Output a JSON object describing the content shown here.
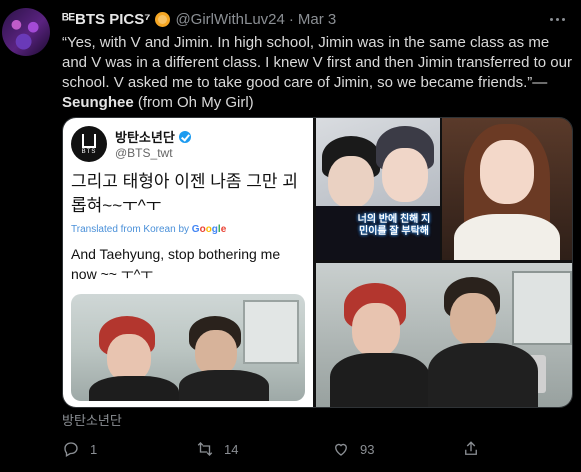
{
  "tweet": {
    "display_name": "ᴮᴱBTS PICS⁷",
    "handle": "@GirlWithLuv24",
    "separator": "·",
    "date": "Mar 3",
    "text_quote": "“Yes, with V and Jimin. In high school, Jimin was in the same class as me and V was in a different class. I knew V first and then Jimin transferred to our school. V asked me to take good care of Jimin, so we became friends.”—",
    "text_author": "Seunghee",
    "text_source": " (from Oh My Girl)"
  },
  "embedded": {
    "logo_text": "BTS",
    "name": "방탄소년단",
    "handle": "@BTS_twt",
    "korean_text": "그리고 태형아 이젠 나좀 그만 괴롭혀~~ㅜ^ㅜ",
    "translated_prefix": "Translated from Korean by ",
    "google": [
      "G",
      "o",
      "o",
      "g",
      "l",
      "e"
    ],
    "translation": "And Taehyung, stop bothering me now ~~ ㅜ^ㅜ"
  },
  "media": {
    "photo_caption": "너의 반에 친해 지민이를 잘 부탁해"
  },
  "alt_caption": "방탄소년단",
  "actions": {
    "reply_count": "1",
    "retweet_count": "14",
    "like_count": "93"
  },
  "colors": {
    "background": "#000000",
    "text": "#d9d9d9",
    "muted": "#8b8f94",
    "verified": "#1d9bf0",
    "emoji_badge": "#f5a623"
  }
}
